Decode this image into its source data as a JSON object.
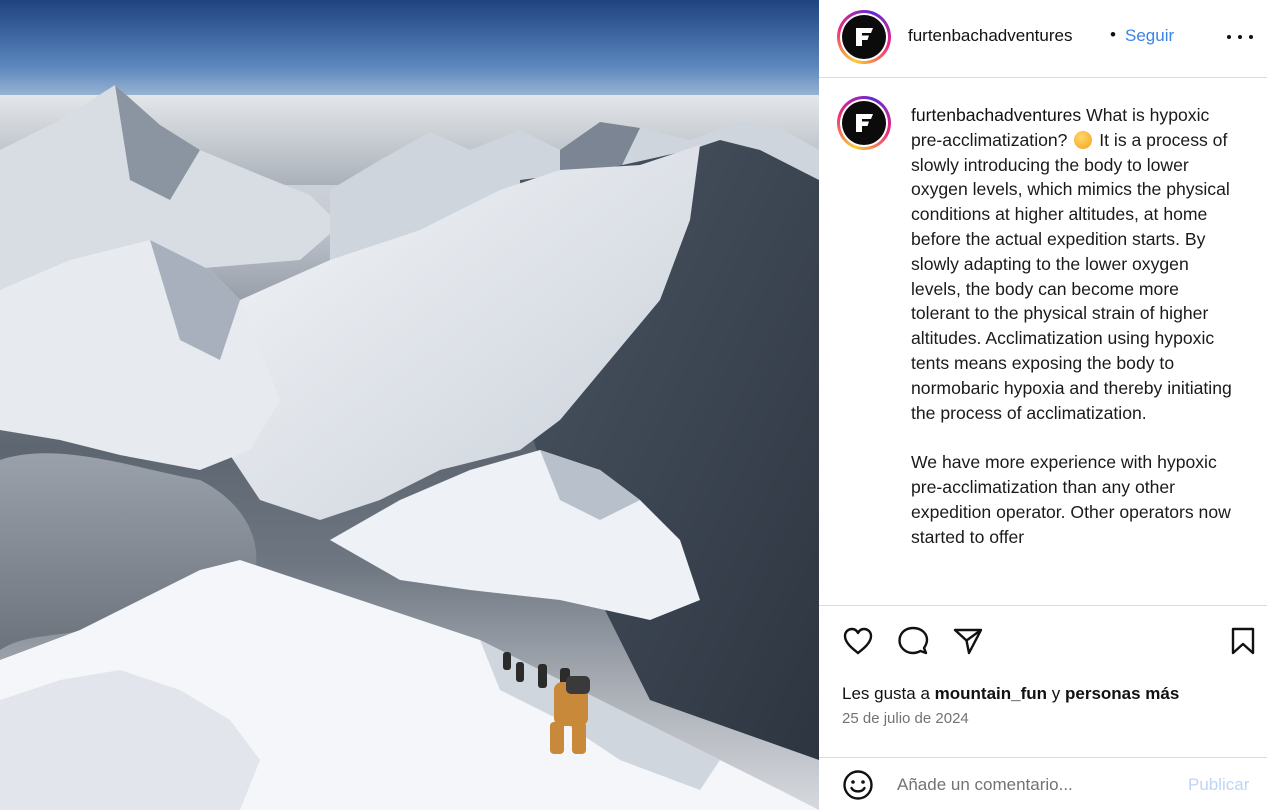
{
  "post": {
    "username": "furtenbachadventures",
    "separator": "•",
    "follow_label": "Seguir",
    "more_icon": "more-horizontal-icon",
    "caption_lines": [
      "It is a process of slowly introducing the body to lower oxygen levels, which mimics the physical conditions at higher altitudes, at home before the actual expedition starts. By slowly adapting to the lower oxygen levels, the body can become more tolerant to the physical strain of higher altitudes. Acclimatization using hypoxic tents means exposing the body to normobaric hypoxia and thereby initiating the process of acclimatization.",
      "We have more experience with hypoxic pre-acclimatization than any other expedition operator. Other operators now started to offer"
    ],
    "caption_intro": "What is hypoxic pre-acclimatization?",
    "caption_emoji": "thinking-face-emoji",
    "likes_prefix": "Les gusta a",
    "likes_user": "mountain_fun",
    "likes_connector": "y",
    "likes_others": "personas más",
    "date": "25 de julio de 2024",
    "comment_placeholder": "Añade un comentario...",
    "publish_label": "Publicar"
  },
  "colors": {
    "accent": "#3b83e6",
    "publish_disabled": "#bcd6f7",
    "muted_text": "#737373",
    "divider": "#dbdbdb"
  },
  "icons": [
    "heart-icon",
    "comment-icon",
    "share-icon",
    "bookmark-icon",
    "emoji-icon"
  ]
}
